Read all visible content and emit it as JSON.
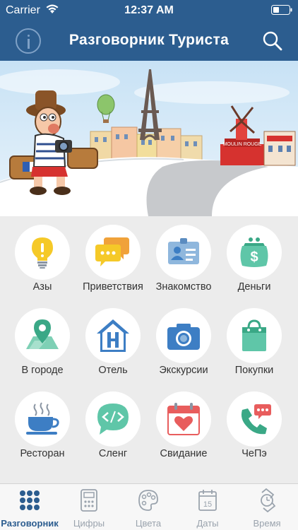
{
  "status": {
    "carrier": "Carrier",
    "time": "12:37 AM"
  },
  "navbar": {
    "title": "Разговорник Туриста",
    "info_icon": "info-icon",
    "search_icon": "search-icon"
  },
  "hero": {
    "sign_text": "MOULIN ROUGE"
  },
  "categories": [
    {
      "label": "Азы",
      "icon": "lightbulb-icon"
    },
    {
      "label": "Приветствия",
      "icon": "chat-bubbles-icon"
    },
    {
      "label": "Знакомство",
      "icon": "id-card-icon"
    },
    {
      "label": "Деньги",
      "icon": "purse-icon"
    },
    {
      "label": "В городе",
      "icon": "map-pin-icon"
    },
    {
      "label": "Отель",
      "icon": "hotel-icon"
    },
    {
      "label": "Экскурсии",
      "icon": "camera-icon"
    },
    {
      "label": "Покупки",
      "icon": "shopping-bag-icon"
    },
    {
      "label": "Ресторан",
      "icon": "coffee-cup-icon"
    },
    {
      "label": "Сленг",
      "icon": "speech-code-icon"
    },
    {
      "label": "Свидание",
      "icon": "calendar-heart-icon"
    },
    {
      "label": "ЧеПэ",
      "icon": "phone-alert-icon"
    }
  ],
  "tabs": [
    {
      "label": "Разговорник",
      "icon": "grid-dots-icon",
      "active": true
    },
    {
      "label": "Цифры",
      "icon": "calculator-icon",
      "active": false
    },
    {
      "label": "Цвета",
      "icon": "palette-icon",
      "active": false
    },
    {
      "label": "Даты",
      "icon": "calendar-icon",
      "active": false,
      "badge": "15"
    },
    {
      "label": "Время",
      "icon": "watch-icon",
      "active": false
    }
  ],
  "colors": {
    "primary": "#2c5d8f",
    "icon_blue": "#3d7ec4",
    "icon_green": "#5fc6a8",
    "icon_red": "#e85d5d",
    "icon_yellow": "#f5c928"
  }
}
